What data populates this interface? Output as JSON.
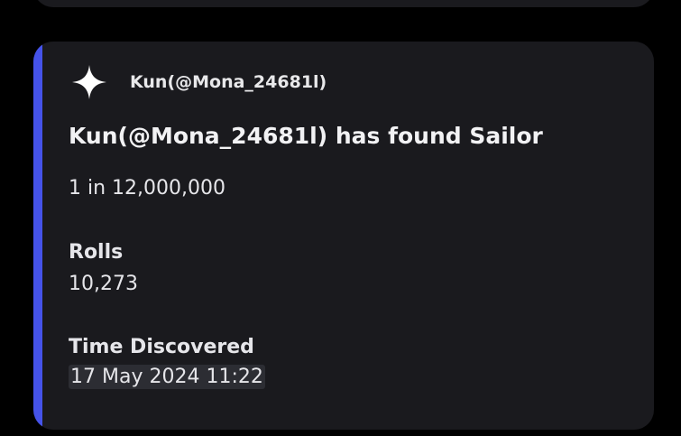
{
  "embed": {
    "accent_color": "#4553ea",
    "author": {
      "icon": "sparkle-icon",
      "name": "Kun(@Mona_24681l)"
    },
    "title": "Kun(@Mona_24681l) has found Sailor",
    "description": "1 in 12,000,000",
    "fields": [
      {
        "name": "Rolls",
        "value": "10,273"
      },
      {
        "name": "Time Discovered",
        "value": "17 May 2024 11:22"
      }
    ]
  }
}
